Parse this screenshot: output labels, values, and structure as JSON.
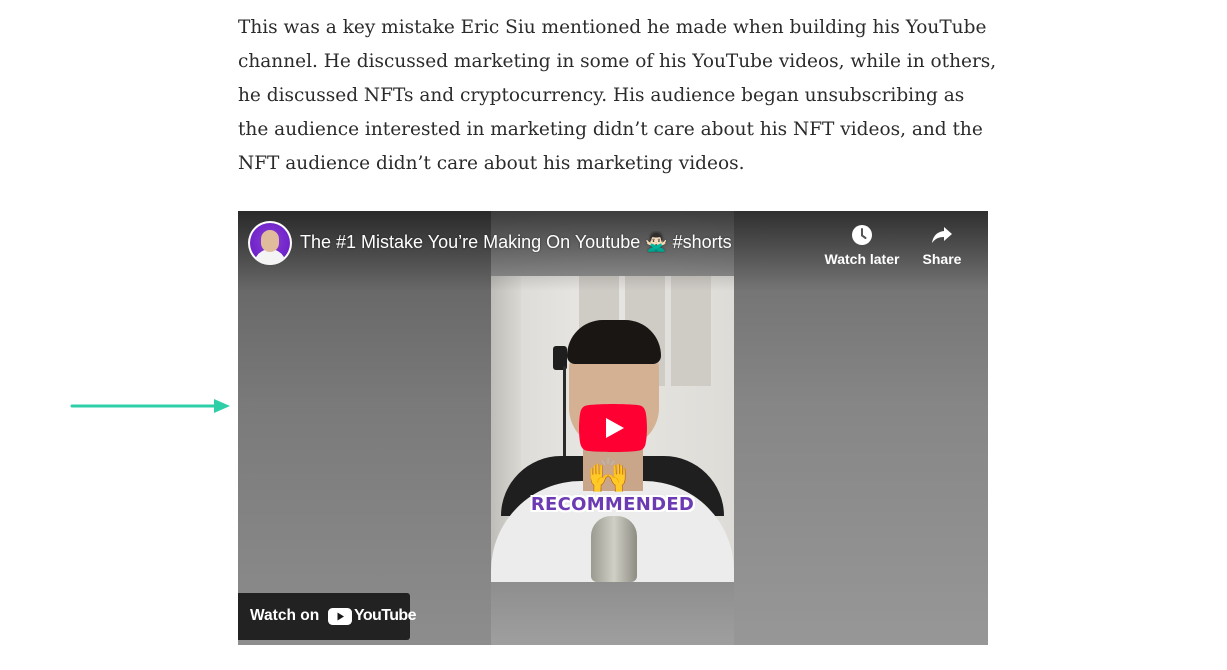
{
  "article": {
    "paragraph": "This was a key mistake Eric Siu mentioned he made when building his YouTube channel. He discussed marketing in some of his YouTube videos, while in others, he discussed NFTs and cryptocurrency. His audience began unsubscribing as the audience interested in marketing didn’t care about his NFT videos, and the NFT audience didn’t care about his marketing videos."
  },
  "annotation": {
    "arrow_color": "#2ecfa8",
    "icon": "right-arrow-icon"
  },
  "video": {
    "title": "The #1 Mistake You’re Making On Youtube 🙅🏻‍♂️ #shorts",
    "thumbnail_caption": "RECOMMENDED",
    "thumbnail_emoji": "🙌",
    "actions": {
      "watch_later": "Watch later",
      "share": "Share"
    },
    "watch_on": {
      "label": "Watch on",
      "brand": "YouTube"
    },
    "colors": {
      "play_button": "#ff0033",
      "caption": "#6c3bb4",
      "channel_avatar_bg": "#7327cc"
    },
    "icons": [
      "clock-icon",
      "share-arrow-icon",
      "play-icon",
      "youtube-logo-icon"
    ]
  }
}
